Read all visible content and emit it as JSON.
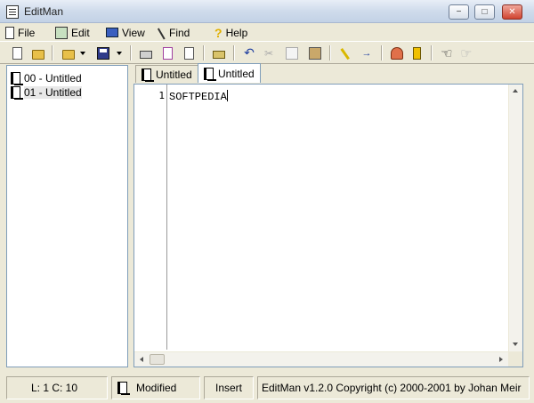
{
  "window": {
    "title": "EditMan",
    "minimize": "−",
    "maximize": "□",
    "close": "✕"
  },
  "menu": [
    {
      "label": "File",
      "icon": "file-menu-icon"
    },
    {
      "label": "Edit",
      "icon": "edit-menu-icon"
    },
    {
      "label": "View",
      "icon": "view-menu-icon"
    },
    {
      "label": "Find",
      "icon": "find-menu-icon"
    },
    {
      "label": "Help",
      "icon": "help-menu-icon",
      "glyph": "?"
    }
  ],
  "toolbar": {
    "icons": [
      "new-icon",
      "open-icon",
      "open-dropdown-icon",
      "save-icon",
      "save-dropdown-icon",
      "print-icon",
      "print-preview-page-icon",
      "print-preview-icon",
      "tag-icon",
      "undo-icon",
      "cut-icon",
      "copy-icon",
      "paste-icon",
      "highlight-icon",
      "goto-icon",
      "person-icon",
      "exit-icon",
      "back-icon",
      "forward-icon"
    ],
    "undo_glyph": "↶",
    "cut_glyph": "✂",
    "goto_glyph": "→",
    "back_glyph": "☜",
    "forward_glyph": "☞"
  },
  "side_panel": {
    "items": [
      {
        "label": "00 - Untitled",
        "selected": false
      },
      {
        "label": "01 - Untitled",
        "selected": true
      }
    ]
  },
  "tabs": [
    {
      "label": "Untitled",
      "active": false
    },
    {
      "label": "Untitled",
      "active": true
    }
  ],
  "editor": {
    "lines": [
      {
        "number": "1",
        "text": "SOFTPEDIA"
      }
    ]
  },
  "status": {
    "position": "L:  1  C:  10",
    "modified": "Modified",
    "mode": "Insert",
    "copyright": "EditMan v1.2.0 Copyright (c) 2000-2001 by Johan Meir"
  }
}
